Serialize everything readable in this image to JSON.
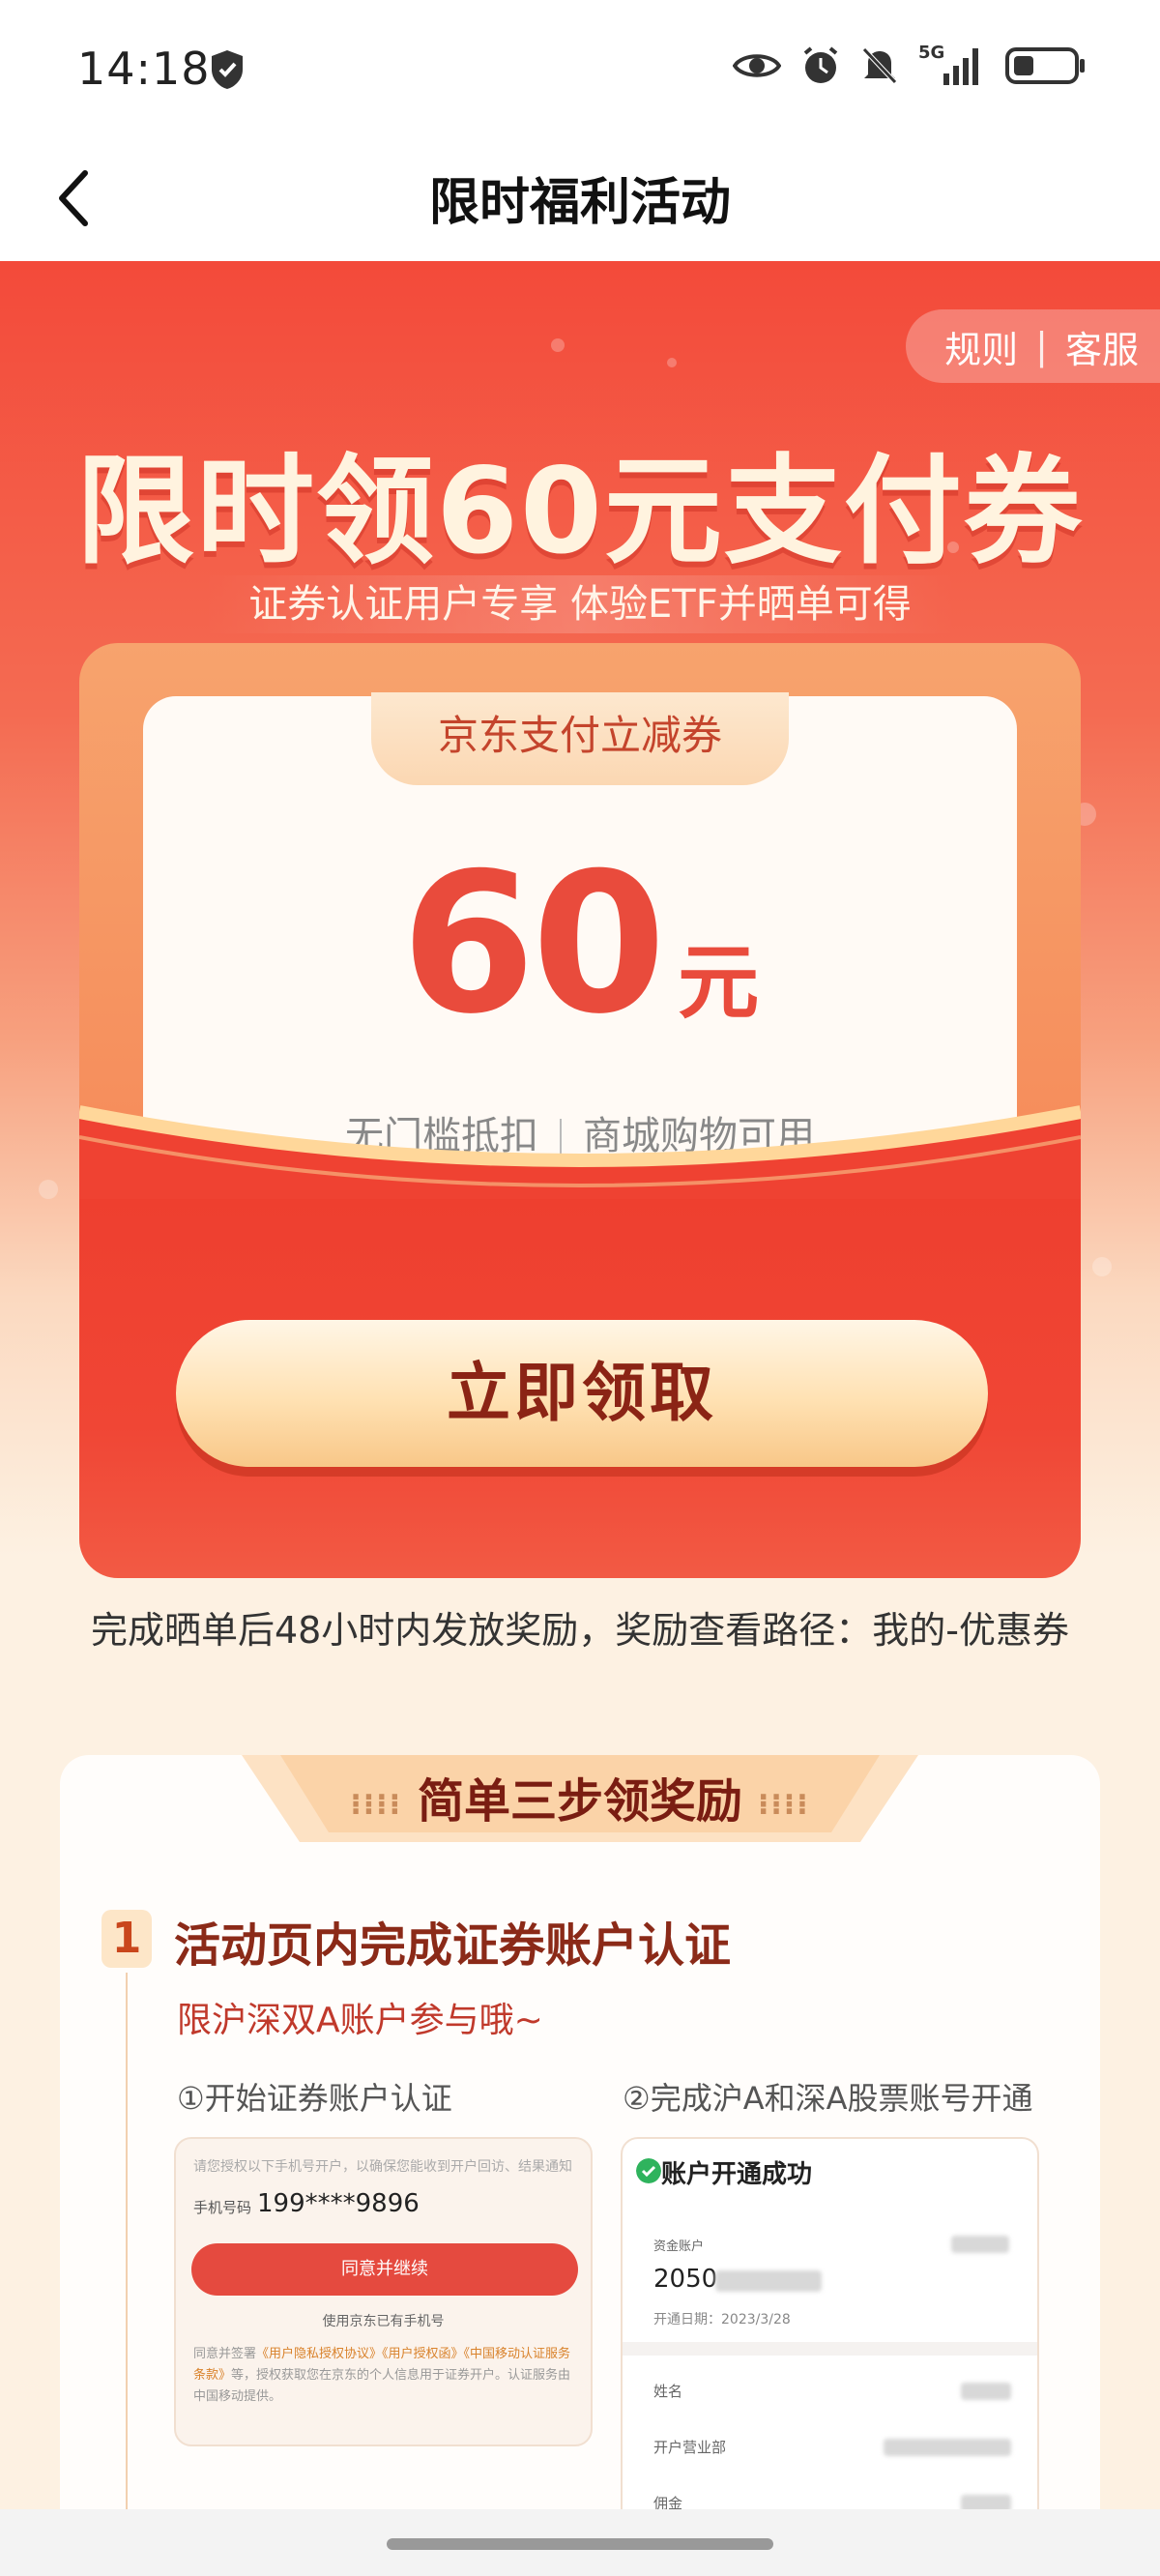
{
  "status_bar": {
    "time": "14:18",
    "network": "5G",
    "icons": [
      "shield-icon",
      "eye-icon",
      "alarm-icon",
      "mute-icon",
      "signal-icon",
      "battery-icon"
    ]
  },
  "nav": {
    "title": "限时福利活动",
    "back_icon": "chevron-left-icon"
  },
  "hero": {
    "rules": "规则",
    "service": "客服",
    "title": "限时领60元支付券",
    "subtitle": "证券认证用户专享 体验ETF并晒单可得"
  },
  "coupon": {
    "tab": "京东支付立减券",
    "amount": "60",
    "unit": "元",
    "desc_left": "无门槛抵扣",
    "desc_right": "商城购物可用"
  },
  "claim_button": "立即领取",
  "reward_note": "完成晒单后48小时内发放奖励，奖励查看路径：我的-优惠券",
  "steps": {
    "title": "简单三步领奖励",
    "step1": {
      "num": "1",
      "title": "活动页内完成证券账户认证",
      "subtitle": "限沪深双A账户参与哦~",
      "sub_left": "①开始证券账户认证",
      "sub_right": "②完成沪A和深A股票账号开通"
    }
  },
  "mock_left": {
    "notice": "请您授权以下手机号开户，以确保您能收到开户回访、结果通知",
    "phone_label": "手机号码",
    "phone_value": "199****9896",
    "agree_button": "同意并继续",
    "alt_link": "使用京东已有手机号",
    "legal_prefix": "同意并签署",
    "legal_links": "《用户隐私授权协议》《用户授权函》《中国移动认证服务条款》",
    "legal_suffix": "等，授权获取您在京东的个人信息用于证券开户。认证服务由中国移动提供。"
  },
  "mock_right": {
    "success": "账户开通成功",
    "fund_label": "资金账户",
    "fund_value": "2050",
    "open_date": "开通日期：2023/3/28",
    "name_label": "姓名",
    "branch_label": "开户营业部",
    "commission_label": "佣金"
  },
  "colors": {
    "brand_red": "#f34a3a",
    "gold": "#ffe1b2",
    "dark_red_text": "#8b2415"
  }
}
